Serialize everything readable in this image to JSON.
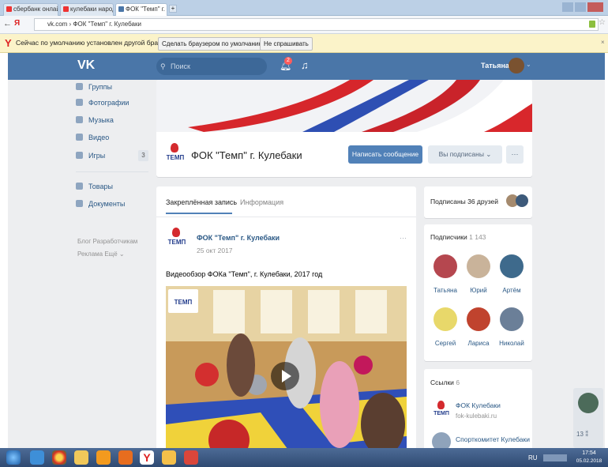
{
  "browser": {
    "tabs": [
      {
        "label": "сбербанк онлайн"
      },
      {
        "label": "кулебаки народ"
      },
      {
        "label": "ФОК \"Темп\" г. Ку ×"
      }
    ],
    "address": "vk.com › ФОК \"Темп\" г. Кулебаки",
    "info_text": "Сейчас по умолчанию установлен другой браузер.",
    "make_default_label": "Сделать браузером по умолчанию",
    "dont_ask_label": "Не спрашивать"
  },
  "vk": {
    "search_placeholder": "Поиск",
    "notif_count": "2",
    "user_name": "Татьяна"
  },
  "sidebar": {
    "items": [
      {
        "label": "Группы"
      },
      {
        "label": "Фотографии"
      },
      {
        "label": "Музыка"
      },
      {
        "label": "Видео"
      },
      {
        "label": "Игры",
        "badge": "3"
      },
      {
        "label": "Товары"
      },
      {
        "label": "Документы"
      }
    ],
    "footer1": "Блог  Разработчикам",
    "footer2": "Реклама  Ещё ⌄"
  },
  "group": {
    "name": "ФОК \"Темп\" г. Кулебаки",
    "logo_text": "ТЕМП",
    "message_btn": "Написать сообщение",
    "subscribed_btn": "Вы подписаны ⌄",
    "more": "···"
  },
  "tabs": {
    "pinned": "Закреплённая запись",
    "info": "Информация"
  },
  "post": {
    "author": "ФОК \"Темп\" г. Кулебаки",
    "date": "25 окт 2017",
    "text": "Видеообзор ФОКа \"Темп\", г. Кулебаки, 2017 год",
    "more": "···"
  },
  "friends": {
    "label": "Подписаны 36 друзей"
  },
  "followers": {
    "title": "Подписчики",
    "count": "1 143",
    "people": [
      {
        "name": "Татьяна"
      },
      {
        "name": "Юрий"
      },
      {
        "name": "Артём"
      },
      {
        "name": "Сергей"
      },
      {
        "name": "Лариса"
      },
      {
        "name": "Николай"
      }
    ]
  },
  "links": {
    "title": "Ссылки",
    "count": "6",
    "items": [
      {
        "title": "ФОК Кулебаки",
        "url": "fok-kulebaki.ru"
      },
      {
        "title": "Спорткомитет Кулебаки",
        "url": ""
      }
    ]
  },
  "right_float": {
    "count": "13 ⁑"
  },
  "taskbar": {
    "lang": "RU",
    "time": "17:54",
    "date": "05.02.2018"
  },
  "colors": {
    "vk_blue": "#4a76a8",
    "button_blue": "#5181b8",
    "link": "#2a5885"
  }
}
